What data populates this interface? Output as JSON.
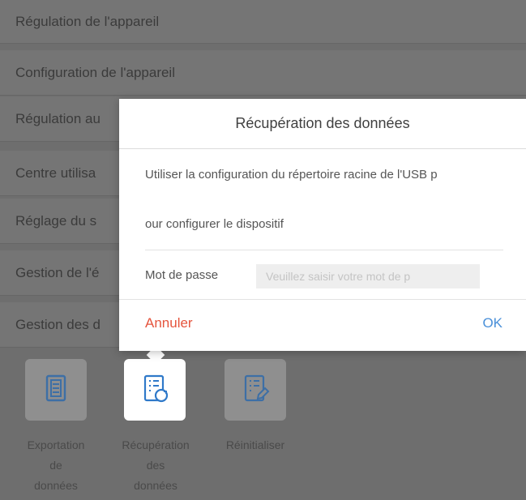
{
  "menu": {
    "items": [
      {
        "label": "Régulation de l'appareil"
      },
      {
        "label": "Configuration de l'appareil"
      },
      {
        "label": "Régulation au"
      },
      {
        "label": "Centre utilisa"
      },
      {
        "label": "Réglage du s"
      },
      {
        "label": "Gestion de l'é"
      },
      {
        "label": "Gestion des d"
      }
    ]
  },
  "tools": [
    {
      "label_lines": [
        "Exportation",
        "de",
        "données"
      ],
      "icon": "export-data-icon"
    },
    {
      "label_lines": [
        "Récupération",
        "des",
        "données"
      ],
      "icon": "data-recovery-icon"
    },
    {
      "label_lines": [
        "Réinitialiser"
      ],
      "icon": "reset-icon"
    }
  ],
  "dialog": {
    "title": "Récupération des données",
    "message_line1": "Utiliser la configuration du répertoire racine de l'USB p",
    "message_line2": "our configurer le dispositif",
    "password_label": "Mot de passe",
    "password_placeholder": "Veuillez saisir votre mot de p",
    "cancel_label": "Annuler",
    "ok_label": "OK"
  },
  "colors": {
    "cancel": "#e5543d",
    "ok": "#4a90d9"
  }
}
